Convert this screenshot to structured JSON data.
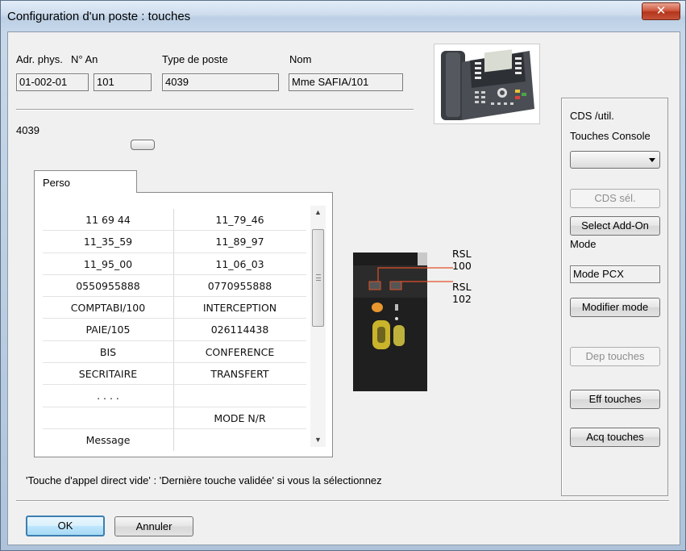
{
  "window": {
    "title": "Configuration d'un poste : touches",
    "close_icon": "close-icon"
  },
  "header_fields": {
    "adr_phys": {
      "label": "Adr. phys.",
      "value": "01-002-01"
    },
    "n_an": {
      "label": "N° An",
      "value": "101"
    },
    "type_poste": {
      "label": "Type de poste",
      "value": "4039"
    },
    "nom": {
      "label": "Nom",
      "value": "Mme SAFIA/101"
    }
  },
  "model_label": "4039",
  "tab": {
    "label": "Perso"
  },
  "keys": [
    [
      "11 69 44",
      "11_79_46"
    ],
    [
      "11_35_59",
      "11_89_97"
    ],
    [
      "11_95_00",
      "11_06_03"
    ],
    [
      "0550955888",
      "0770955888"
    ],
    [
      "COMPTABI/100",
      "INTERCEPTION"
    ],
    [
      "PAIE/105",
      "026114438"
    ],
    [
      "BIS",
      "CONFERENCE"
    ],
    [
      "SECRITAIRE",
      "TRANSFERT"
    ],
    [
      ". . . .",
      ""
    ],
    [
      "",
      "MODE N/R"
    ],
    [
      "Message",
      ""
    ]
  ],
  "keypad_callouts": {
    "rsl1": "RSL",
    "rsl1_num": "100",
    "rsl2": "RSL",
    "rsl2_num": "102"
  },
  "right_panel": {
    "cds_util": "CDS  /util.",
    "touches_console": "Touches Console",
    "combo_value": "",
    "cds_sel": "CDS sél.",
    "select_addon": "Select Add-On",
    "mode_label": "Mode",
    "mode_value": "Mode PCX",
    "modifier_mode": "Modifier mode",
    "dep_touches": "Dep touches",
    "eff_touches": "Eff touches",
    "acq_touches": "Acq touches"
  },
  "hint": "'Touche d'appel direct vide' : 'Dernière touche validée' si vous la sélectionnez",
  "buttons": {
    "ok": "OK",
    "cancel": "Annuler"
  },
  "colors": {
    "accent_red": "#e0502a",
    "ok_border": "#3c7fb1"
  }
}
